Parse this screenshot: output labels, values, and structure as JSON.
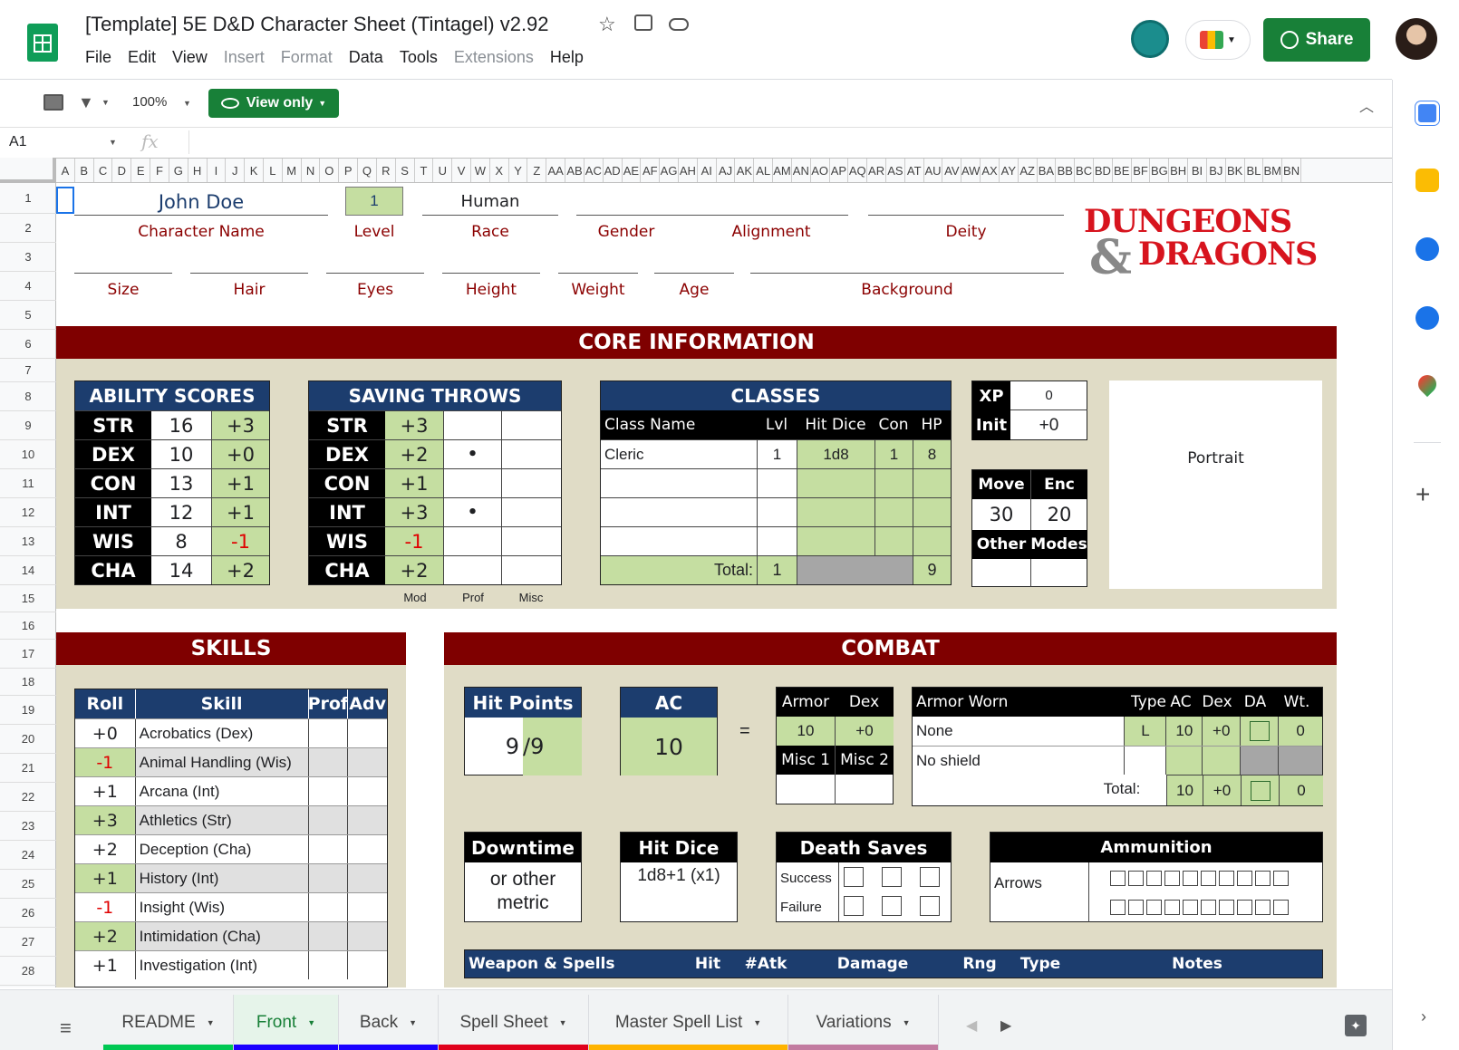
{
  "doc": {
    "title": "[Template] 5E D&D Character Sheet (Tintagel) v2.92",
    "menus": [
      "File",
      "Edit",
      "View",
      "Insert",
      "Format",
      "Data",
      "Tools",
      "Extensions",
      "Help"
    ],
    "share": "Share"
  },
  "toolbar": {
    "zoom": "100%",
    "view_only": "View only"
  },
  "formula": {
    "cell": "A1",
    "fx": "fx"
  },
  "columns": [
    "A",
    "B",
    "C",
    "D",
    "E",
    "F",
    "G",
    "H",
    "I",
    "J",
    "K",
    "L",
    "M",
    "N",
    "O",
    "P",
    "Q",
    "R",
    "S",
    "T",
    "U",
    "V",
    "W",
    "X",
    "Y",
    "Z",
    "AA",
    "AB",
    "AC",
    "AD",
    "AE",
    "AF",
    "AG",
    "AH",
    "AI",
    "AJ",
    "AK",
    "AL",
    "AM",
    "AN",
    "AO",
    "AP",
    "AQ",
    "AR",
    "AS",
    "AT",
    "AU",
    "AV",
    "AW",
    "AX",
    "AY",
    "AZ",
    "BA",
    "BB",
    "BC",
    "BD",
    "BE",
    "BF",
    "BG",
    "BH",
    "BI",
    "BJ",
    "BK",
    "BL",
    "BM",
    "BN"
  ],
  "rows": [
    "1",
    "2",
    "3",
    "4",
    "5",
    "6",
    "7",
    "8",
    "9",
    "10",
    "11",
    "12",
    "13",
    "14",
    "15",
    "16",
    "17",
    "18",
    "19",
    "20",
    "21",
    "22",
    "23",
    "24",
    "25",
    "26",
    "27",
    "28"
  ],
  "char": {
    "name": "John Doe",
    "level": "1",
    "race": "Human",
    "labels": {
      "name": "Character Name",
      "level": "Level",
      "race": "Race",
      "gender": "Gender",
      "alignment": "Alignment",
      "deity": "Deity",
      "size": "Size",
      "hair": "Hair",
      "eyes": "Eyes",
      "height": "Height",
      "weight": "Weight",
      "age": "Age",
      "background": "Background"
    }
  },
  "logo": {
    "line1": "DUNGEONS",
    "amp": "&",
    "line2": "DRAGONS"
  },
  "core": {
    "title": "CORE INFORMATION"
  },
  "abilities": {
    "title": "ABILITY SCORES",
    "rows": [
      {
        "a": "STR",
        "s": "16",
        "m": "+3",
        "neg": false
      },
      {
        "a": "DEX",
        "s": "10",
        "m": "+0",
        "neg": false
      },
      {
        "a": "CON",
        "s": "13",
        "m": "+1",
        "neg": false
      },
      {
        "a": "INT",
        "s": "12",
        "m": "+1",
        "neg": false
      },
      {
        "a": "WIS",
        "s": "8",
        "m": "-1",
        "neg": true
      },
      {
        "a": "CHA",
        "s": "14",
        "m": "+2",
        "neg": false
      }
    ]
  },
  "saves": {
    "title": "SAVING THROWS",
    "rows": [
      {
        "a": "STR",
        "m": "+3",
        "p": "",
        "neg": false
      },
      {
        "a": "DEX",
        "m": "+2",
        "p": "•",
        "neg": false
      },
      {
        "a": "CON",
        "m": "+1",
        "p": "",
        "neg": false
      },
      {
        "a": "INT",
        "m": "+3",
        "p": "•",
        "neg": false
      },
      {
        "a": "WIS",
        "m": "-1",
        "p": "",
        "neg": true
      },
      {
        "a": "CHA",
        "m": "+2",
        "p": "",
        "neg": false
      }
    ],
    "foot": [
      "Mod",
      "Prof",
      "Misc"
    ]
  },
  "classes": {
    "title": "CLASSES",
    "headers": [
      "Class Name",
      "Lvl",
      "Hit Dice",
      "Con",
      "HP"
    ],
    "rows": [
      [
        "Cleric",
        "1",
        "1d8",
        "1",
        "8"
      ],
      [
        "",
        "",
        "",
        "",
        ""
      ],
      [
        "",
        "",
        "",
        "",
        ""
      ],
      [
        "",
        "",
        "",
        "",
        ""
      ]
    ],
    "total_label": "Total:",
    "total_lvl": "1",
    "total_hp": "9"
  },
  "xp": {
    "xp_label": "XP",
    "xp": "0",
    "init_label": "Init",
    "init": "+0"
  },
  "move": {
    "move_label": "Move",
    "enc_label": "Enc",
    "move": "30",
    "enc": "20",
    "other": "Other",
    "modes": "Modes"
  },
  "portrait": "Portrait",
  "skills": {
    "title": "SKILLS",
    "headers": [
      "Roll",
      "Skill",
      "Prof",
      "Adv"
    ],
    "rows": [
      {
        "r": "+0",
        "s": "Acrobatics (Dex)",
        "neg": false
      },
      {
        "r": "-1",
        "s": "Animal Handling (Wis)",
        "neg": true
      },
      {
        "r": "+1",
        "s": "Arcana (Int)",
        "neg": false
      },
      {
        "r": "+3",
        "s": "Athletics (Str)",
        "neg": false
      },
      {
        "r": "+2",
        "s": "Deception (Cha)",
        "neg": false
      },
      {
        "r": "+1",
        "s": "History (Int)",
        "neg": false
      },
      {
        "r": "-1",
        "s": "Insight (Wis)",
        "neg": true
      },
      {
        "r": "+2",
        "s": "Intimidation (Cha)",
        "neg": false
      },
      {
        "r": "+1",
        "s": "Investigation (Int)",
        "neg": false
      }
    ]
  },
  "combat": {
    "title": "COMBAT",
    "hp_label": "Hit Points",
    "hp_cur": "9",
    "hp_max": "/9",
    "ac_label": "AC",
    "ac": "10",
    "eq": "=",
    "armor": "Armor",
    "dex": "Dex",
    "armor_val": "10",
    "dex_val": "+0",
    "misc1": "Misc 1",
    "misc2": "Misc 2",
    "worn": {
      "headers": [
        "Armor Worn",
        "Type",
        "AC",
        "Dex",
        "DA",
        "Wt."
      ],
      "rows": [
        {
          "name": "None",
          "type": "L",
          "ac": "10",
          "dex": "+0",
          "wt": "0"
        },
        {
          "name": "No shield",
          "type": "",
          "ac": "",
          "dex": "",
          "wt": ""
        }
      ],
      "total_label": "Total:",
      "total_ac": "10",
      "total_dex": "+0",
      "total_wt": "0"
    },
    "downtime": "Downtime",
    "downtime_val": "or other metric",
    "hitdice": "Hit Dice",
    "hitdice_val": "1d8+1 (x1)",
    "death": "Death Saves",
    "success": "Success",
    "failure": "Failure",
    "ammo": "Ammunition",
    "arrows": "Arrows",
    "weapons": [
      "Weapon & Spells",
      "Hit",
      "#Atk",
      "Damage",
      "Rng",
      "Type",
      "Notes"
    ]
  },
  "tabs": [
    "README",
    "Front",
    "Back",
    "Spell Sheet",
    "Master Spell List",
    "Variations"
  ],
  "tab_colors": [
    "#00c853",
    "#1a00ff",
    "#1a00ff",
    "#e0001b",
    "#ffb300",
    "#c27ba0"
  ]
}
